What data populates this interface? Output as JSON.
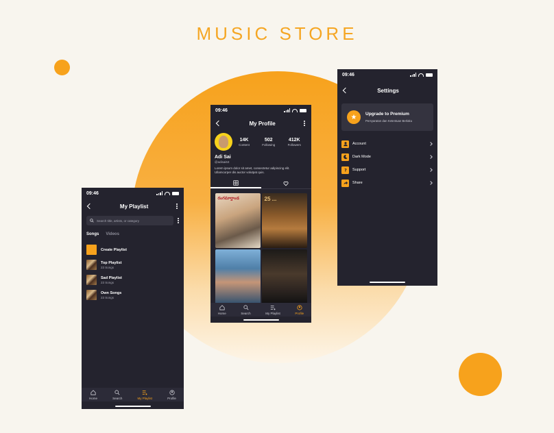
{
  "page": {
    "title": "MUSIC STORE"
  },
  "colors": {
    "accent": "#f7a21c",
    "background": "#f8f5ee",
    "phone_bg": "#24232e"
  },
  "playlist_screen": {
    "time": "09:46",
    "title": "My Playlist",
    "search_placeholder": "Search title, artists, or category",
    "segments": [
      "Songs",
      "Videos"
    ],
    "create_label": "Create Playlist",
    "playlists": [
      {
        "name": "Top Playlist",
        "count": "23 Songs"
      },
      {
        "name": "Sad Playlist",
        "count": "23 Songs"
      },
      {
        "name": "Own Songs",
        "count": "23 Songs"
      }
    ],
    "tabs": [
      "Home",
      "Search",
      "My Playlist",
      "Profile"
    ],
    "active_tab": "My Playlist"
  },
  "profile_screen": {
    "time": "09:46",
    "title": "My Profile",
    "stats": [
      {
        "value": "14K",
        "label": "Content"
      },
      {
        "value": "502",
        "label": "Following"
      },
      {
        "value": "412K",
        "label": "Followers"
      }
    ],
    "name": "Adi Sai",
    "handle": "@adisai63",
    "bio": "Lorem ipsum dolor sit amet, consectetur adipiscing elit. Ullamcorper dis auctor volutpat quis.",
    "posters": [
      {
        "title": "రంగమార్తాండ"
      },
      {
        "title": "25 ..."
      },
      {
        "title": ""
      },
      {
        "title": ""
      }
    ],
    "tabs": [
      "Home",
      "Search",
      "My Playlist",
      "Profile"
    ],
    "active_tab": "Profile"
  },
  "settings_screen": {
    "time": "09:46",
    "title": "Settings",
    "premium_title": "Upgrade to Premium",
    "premium_sub": "Persyaratan dan Ketentuan Berlaku",
    "items": [
      {
        "label": "Account",
        "icon": "user-icon"
      },
      {
        "label": "Dark Mode",
        "icon": "moon-icon"
      },
      {
        "label": "Support",
        "icon": "question-icon"
      },
      {
        "label": "Share",
        "icon": "share-icon"
      }
    ]
  }
}
